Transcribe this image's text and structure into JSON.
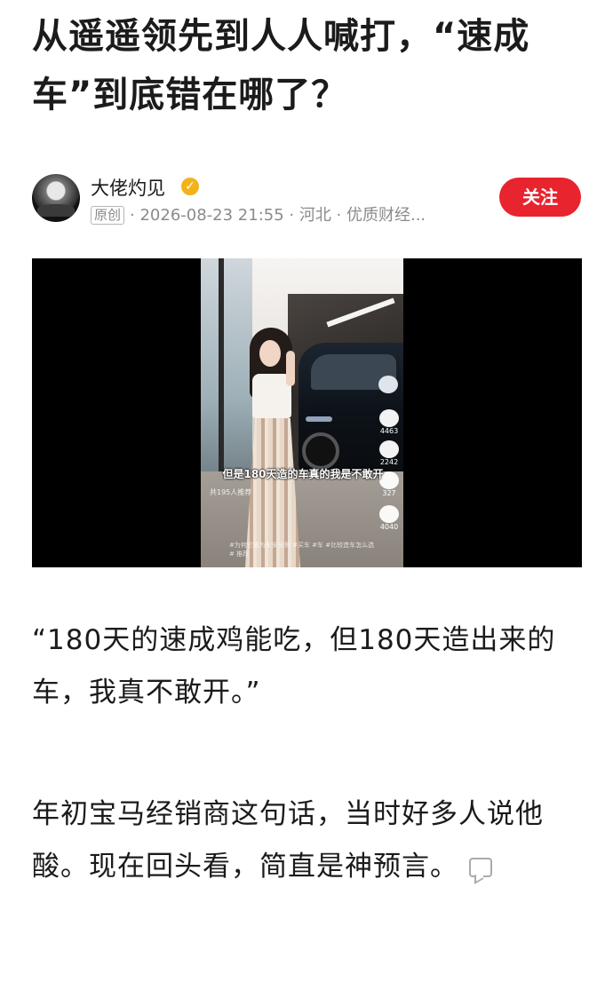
{
  "article": {
    "title": "从遥遥领先到人人喊打，“速成车”到底错在哪了？",
    "author": {
      "name": "大佬灼见",
      "verified_icon": "verified-badge-icon",
      "original_label": "原创",
      "meta": "· 2026-08-23 21:55 · 河北 · 优质财经..."
    },
    "follow_label": "关注",
    "video": {
      "caption": "但是180天造的车真的我是不敢开",
      "likes": "4463",
      "comments": "2242",
      "favorites": "327",
      "shares": "4040",
      "watching": "共195人推荐",
      "hashtags": "#为何它成为车安全例 #买车 #车 #比较造车怎么选 # 推荐",
      "icons": [
        "heart-icon",
        "comment-icon",
        "star-icon",
        "share-icon"
      ]
    },
    "paragraphs": [
      "“180天的速成鸡能吃，但180天造出来的车，我真不敢开。”",
      "年初宝马经销商这句话，当时好多人说他酸。现在回头看，简直是神预言。"
    ],
    "colors": {
      "accent": "#e8242e",
      "verified": "#f2b21a",
      "meta": "#8b8b8b"
    }
  }
}
